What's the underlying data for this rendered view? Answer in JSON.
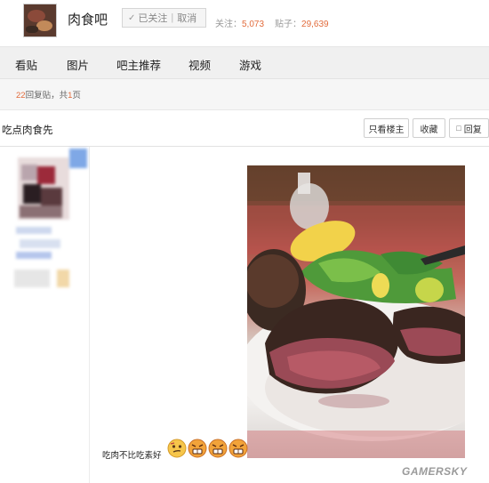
{
  "header": {
    "forum_name": "肉食吧",
    "follow_check": "✓",
    "followed_label": "已关注",
    "cancel_label": "取消",
    "follow_stat_label": "关注：",
    "follow_count": "5,073",
    "post_stat_label": "贴子：",
    "post_count": "29,639"
  },
  "nav": {
    "items": [
      {
        "label": "看贴"
      },
      {
        "label": "图片"
      },
      {
        "label": "吧主推荐"
      },
      {
        "label": "视频"
      },
      {
        "label": "游戏"
      }
    ]
  },
  "reply_bar": {
    "reply_count": "22",
    "reply_text": "回复贴，共",
    "page_count": "1",
    "page_text": "页"
  },
  "thread": {
    "title": "吃点肉食先",
    "only_op_label": "只看楼主",
    "favorite_label": "收藏",
    "reply_label": "回复"
  },
  "post": {
    "caption": "吃肉不比吃素好"
  },
  "watermark": "GAMERSKY",
  "colors": {
    "accent": "#e26b3b",
    "nav_bg": "#f0f0f0"
  }
}
